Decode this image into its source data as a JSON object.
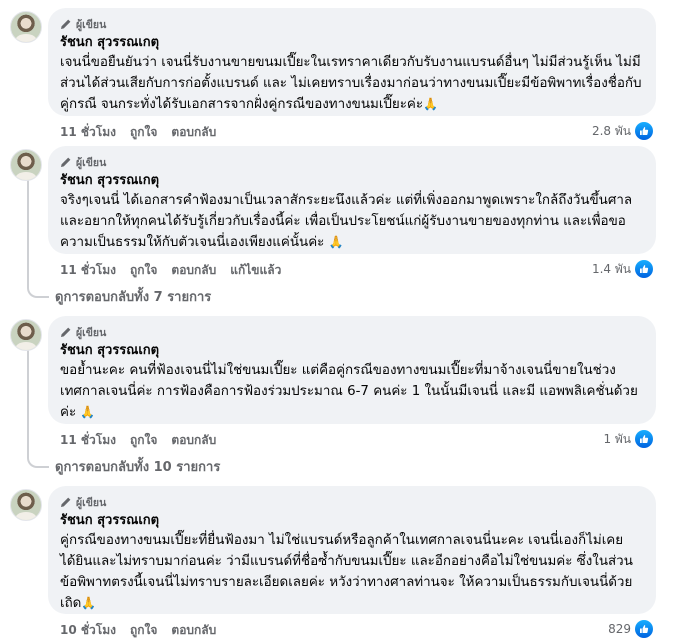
{
  "comments": [
    {
      "badge": "ผู้เขียน",
      "author": "รัชนก สุวรรณเกตุ",
      "text": "เจนนี่ขอยืนยันว่า เจนนี่รับงานขายขนมเปี๊ยะในเรทราคาเดียวกับรับงานแบรนด์อื่นๆ ไม่มีส่วนรู้เห็น ไม่มีส่วนได้ส่วนเสียกับการก่อตั้งแบรนด์ และ ไม่เคยทราบเรื่องมาก่อนว่าทางขนมเปี๊ยะมีข้อพิพาทเรื่องชื่อกับคู่กรณี จนกระทั่งได้รับเอกสารจากฝั่งคู่กรณีของทางขนมเปี๊ยะค่ะ",
      "emoji": "🙏",
      "time": "11 ชั่วโมง",
      "like": "ถูกใจ",
      "reply": "ตอบกลับ",
      "edited": "",
      "reactions": "2.8 พัน",
      "view_replies": ""
    },
    {
      "badge": "ผู้เขียน",
      "author": "รัชนก สุวรรณเกตุ",
      "text": "จริงๆเจนนี่ ได้เอกสารคำฟ้องมาเป็นเวลาสักระยะนึงแล้วค่ะ แต่ที่เพิ่งออกมาพูดเพราะใกล้ถึงวันขึ้นศาล และอยากให้ทุกคนได้รับรู้เกี่ยวกับเรื่องนี้ค่ะ เพื่อเป็นประโยชน์แก่ผู้รับงานขายของทุกท่าน และเพื่อขอความเป็นธรรมให้กับตัวเจนนี่เองเพียงแค่นั้นค่ะ",
      "emoji": "🙏",
      "time": "11 ชั่วโมง",
      "like": "ถูกใจ",
      "reply": "ตอบกลับ",
      "edited": "แก้ไขแล้ว",
      "reactions": "1.4 พัน",
      "view_replies": "ดูการตอบกลับทั้ง 7 รายการ"
    },
    {
      "badge": "ผู้เขียน",
      "author": "รัชนก สุวรรณเกตุ",
      "text": "ขอย้ำนะคะ คนที่ฟ้องเจนนี่ไม่ใช่ขนมเปี๊ยะ แต่คือคู่กรณีของทางขนมเปี๊ยะที่มาจ้างเจนนี่ขายในช่วงเทศกาลเจนนี่ค่ะ การฟ้องคือการฟ้องร่วมประมาณ 6-7 คนค่ะ 1 ในนั้นมีเจนนี่ และมี แอพพลิเคชั่นด้วยค่ะ",
      "emoji": "🙏",
      "time": "11 ชั่วโมง",
      "like": "ถูกใจ",
      "reply": "ตอบกลับ",
      "edited": "",
      "reactions": "1 พัน",
      "view_replies": "ดูการตอบกลับทั้ง 10 รายการ"
    },
    {
      "badge": "ผู้เขียน",
      "author": "รัชนก สุวรรณเกตุ",
      "text": "คู่กรณีของทางขนมเปี๊ยะที่ยื่นฟ้องมา ไม่ใช่แบรนด์หรือลูกค้าในเทศกาลเจนนี่นะคะ เจนนี่เองก็ไม่เคยได้ยินและไม่ทราบมาก่อนค่ะ ว่ามีแบรนด์ที่ชื่อซ้ำกับขนมเปี๊ยะ และอีกอย่างคือไม่ใช่ขนมค่ะ ซึ่งในส่วนข้อพิพาทตรงนี้เจนนี่ไม่ทราบรายละเอียดเลยค่ะ หวังว่าทางศาลท่านจะ ให้ความเป็นธรรมกับเจนนี่ด้วยเถิด",
      "emoji": "🙏",
      "time": "10 ชั่วโมง",
      "like": "ถูกใจ",
      "reply": "ตอบกลับ",
      "edited": "",
      "reactions": "829",
      "view_replies": ""
    }
  ],
  "icons": {
    "author_badge": "pencil-icon",
    "reaction": "like-thumb-icon",
    "avatar": "profile-photo"
  },
  "colors": {
    "bubble": "#f0f2f5",
    "secondary_text": "#65676b",
    "like_blue": "#0866ff"
  }
}
